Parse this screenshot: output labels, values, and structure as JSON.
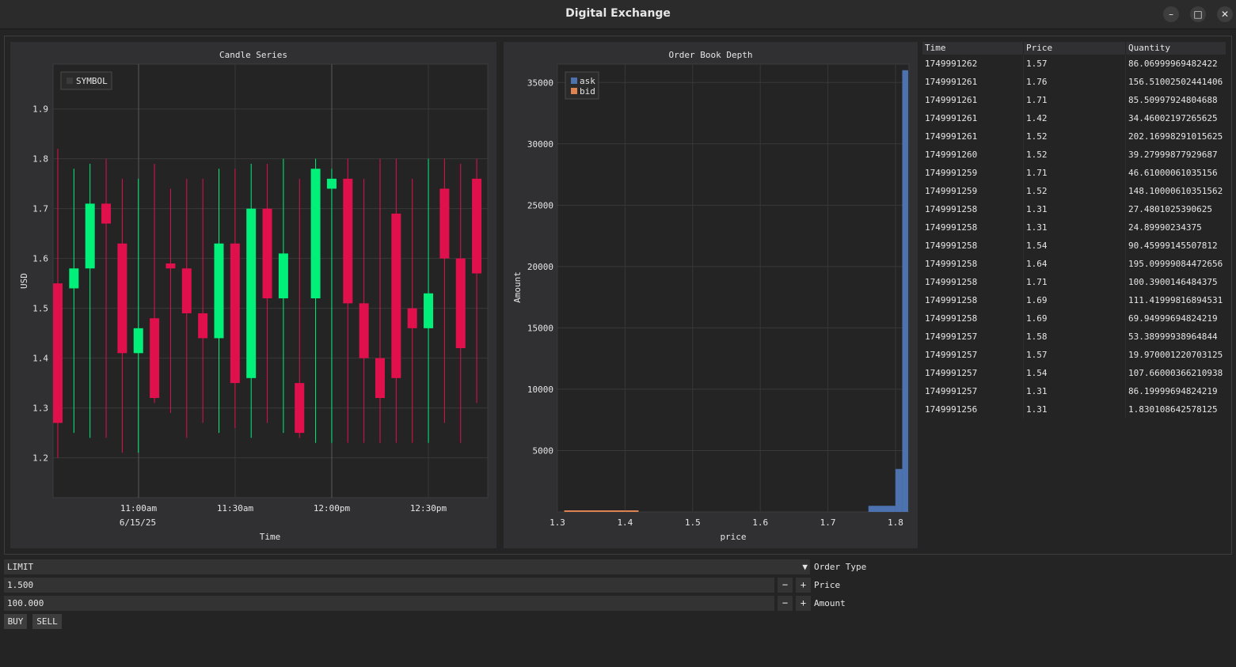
{
  "window": {
    "title": "Digital Exchange",
    "minimize_icon": "minimize-icon",
    "maximize_icon": "maximize-icon",
    "close_icon": "close-icon"
  },
  "candle_panel": {
    "title": "Candle Series",
    "legend": "SYMBOL",
    "chart_data": {
      "type": "candlestick",
      "title": "Candle Series",
      "xlabel": "Time",
      "ylabel": "USD",
      "ylim": [
        1.12,
        1.99
      ],
      "y_ticks": [
        "1.2",
        "1.3",
        "1.4",
        "1.5",
        "1.6",
        "1.7",
        "1.8",
        "1.9"
      ],
      "x_ticks": [
        "11:00am",
        "11:30am",
        "12:00pm",
        "12:30pm"
      ],
      "x_date_label": "6/15/25",
      "legend": [
        "SYMBOL"
      ],
      "grid": true,
      "up_color": "#00f07a",
      "down_color": "#e0104c",
      "series": [
        {
          "open": 1.55,
          "close": 1.27,
          "high": 1.82,
          "low": 1.2
        },
        {
          "open": 1.54,
          "close": 1.58,
          "high": 1.78,
          "low": 1.25
        },
        {
          "open": 1.58,
          "close": 1.71,
          "high": 1.79,
          "low": 1.24
        },
        {
          "open": 1.71,
          "close": 1.67,
          "high": 1.8,
          "low": 1.24
        },
        {
          "open": 1.63,
          "close": 1.41,
          "high": 1.76,
          "low": 1.21
        },
        {
          "open": 1.41,
          "close": 1.46,
          "high": 1.76,
          "low": 1.21
        },
        {
          "open": 1.48,
          "close": 1.32,
          "high": 1.79,
          "low": 1.31
        },
        {
          "open": 1.59,
          "close": 1.58,
          "high": 1.74,
          "low": 1.29
        },
        {
          "open": 1.58,
          "close": 1.49,
          "high": 1.76,
          "low": 1.24
        },
        {
          "open": 1.49,
          "close": 1.44,
          "high": 1.76,
          "low": 1.27
        },
        {
          "open": 1.44,
          "close": 1.63,
          "high": 1.78,
          "low": 1.25
        },
        {
          "open": 1.63,
          "close": 1.35,
          "high": 1.78,
          "low": 1.26
        },
        {
          "open": 1.36,
          "close": 1.7,
          "high": 1.79,
          "low": 1.24
        },
        {
          "open": 1.7,
          "close": 1.52,
          "high": 1.79,
          "low": 1.27
        },
        {
          "open": 1.52,
          "close": 1.61,
          "high": 1.8,
          "low": 1.25
        },
        {
          "open": 1.35,
          "close": 1.25,
          "high": 1.76,
          "low": 1.24
        },
        {
          "open": 1.52,
          "close": 1.78,
          "high": 1.8,
          "low": 1.23
        },
        {
          "open": 1.74,
          "close": 1.76,
          "high": 1.78,
          "low": 1.23
        },
        {
          "open": 1.76,
          "close": 1.51,
          "high": 1.8,
          "low": 1.23
        },
        {
          "open": 1.51,
          "close": 1.4,
          "high": 1.76,
          "low": 1.23
        },
        {
          "open": 1.4,
          "close": 1.32,
          "high": 1.8,
          "low": 1.23
        },
        {
          "open": 1.69,
          "close": 1.36,
          "high": 1.8,
          "low": 1.23
        },
        {
          "open": 1.5,
          "close": 1.46,
          "high": 1.76,
          "low": 1.23
        },
        {
          "open": 1.46,
          "close": 1.53,
          "high": 1.8,
          "low": 1.23
        },
        {
          "open": 1.74,
          "close": 1.6,
          "high": 1.8,
          "low": 1.27
        },
        {
          "open": 1.6,
          "close": 1.42,
          "high": 1.79,
          "low": 1.23
        },
        {
          "open": 1.76,
          "close": 1.57,
          "high": 1.8,
          "low": 1.31
        }
      ]
    }
  },
  "depth_panel": {
    "title": "Order Book Depth",
    "chart_data": {
      "type": "bar",
      "title": "Order Book Depth",
      "xlabel": "price",
      "ylabel": "Amount",
      "xlim": [
        1.3,
        1.82
      ],
      "ylim": [
        0,
        36500
      ],
      "x_ticks": [
        "1.3",
        "1.4",
        "1.5",
        "1.6",
        "1.7",
        "1.8"
      ],
      "y_ticks": [
        "5000",
        "10000",
        "15000",
        "20000",
        "25000",
        "30000",
        "35000"
      ],
      "legend_position": "top-left",
      "grid": true,
      "series": [
        {
          "name": "ask",
          "color": "#4c72b0",
          "bins": [
            {
              "x0": 1.76,
              "x1": 1.8,
              "y": 500
            },
            {
              "x0": 1.8,
              "x1": 1.81,
              "y": 3500
            },
            {
              "x0": 1.81,
              "x1": 1.82,
              "y": 36000
            }
          ]
        },
        {
          "name": "bid",
          "color": "#dd8452",
          "bins": [
            {
              "x0": 1.31,
              "x1": 1.4,
              "y": 120
            },
            {
              "x0": 1.4,
              "x1": 1.42,
              "y": 60
            }
          ]
        }
      ]
    }
  },
  "trades_table": {
    "headers": [
      "Time",
      "Price",
      "Quantity"
    ],
    "rows": [
      [
        "1749991262",
        "1.57",
        "86.06999969482422"
      ],
      [
        "1749991261",
        "1.76",
        "156.51002502441406"
      ],
      [
        "1749991261",
        "1.71",
        "85.50997924804688"
      ],
      [
        "1749991261",
        "1.42",
        "34.46002197265625"
      ],
      [
        "1749991261",
        "1.52",
        "202.16998291015625"
      ],
      [
        "1749991260",
        "1.52",
        "39.27999877929687"
      ],
      [
        "1749991259",
        "1.71",
        "46.61000061035156"
      ],
      [
        "1749991259",
        "1.52",
        "148.10000610351562"
      ],
      [
        "1749991258",
        "1.31",
        "27.4801025390625"
      ],
      [
        "1749991258",
        "1.31",
        "24.89990234375"
      ],
      [
        "1749991258",
        "1.54",
        "90.45999145507812"
      ],
      [
        "1749991258",
        "1.64",
        "195.09999084472656"
      ],
      [
        "1749991258",
        "1.71",
        "100.3900146484375"
      ],
      [
        "1749991258",
        "1.69",
        "111.41999816894531"
      ],
      [
        "1749991258",
        "1.69",
        "69.94999694824219"
      ],
      [
        "1749991257",
        "1.58",
        "53.38999938964844"
      ],
      [
        "1749991257",
        "1.57",
        "19.970001220703125"
      ],
      [
        "1749991257",
        "1.54",
        "107.66000366210938"
      ],
      [
        "1749991257",
        "1.31",
        "86.19999694824219"
      ],
      [
        "1749991256",
        "1.31",
        "1.830108642578125"
      ]
    ]
  },
  "order_form": {
    "order_type_value": "LIMIT",
    "order_type_label": "Order Type",
    "price_value": "1.500",
    "price_label": "Price",
    "amount_value": "100.000",
    "amount_label": "Amount",
    "minus": "−",
    "plus": "+",
    "dropdown_arrow": "▼",
    "buy_label": "BUY",
    "sell_label": "SELL"
  }
}
